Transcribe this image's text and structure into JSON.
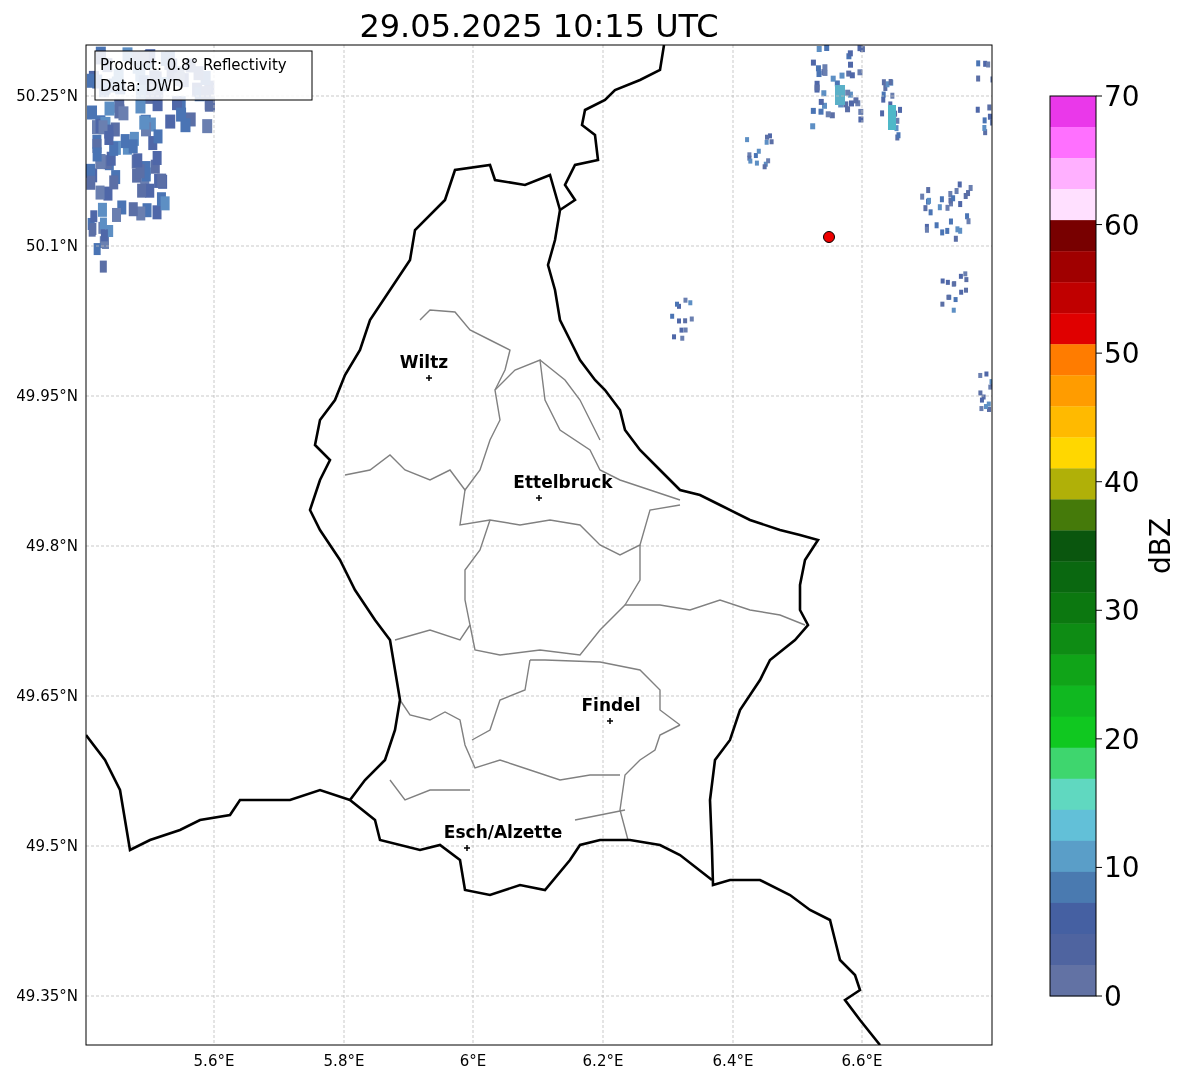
{
  "title": "29.05.2025 10:15 UTC",
  "map": {
    "info_box": [
      "Product: 0.8° Reflectivity",
      "Data: DWD"
    ],
    "cities": [
      {
        "name": "Wiltz"
      },
      {
        "name": "Ettelbruck"
      },
      {
        "name": "Findel"
      },
      {
        "name": "Esch/Alzette"
      }
    ],
    "y_ticks": [
      "50.25°N",
      "50.1°N",
      "49.95°N",
      "49.8°N",
      "49.65°N",
      "49.5°N",
      "49.35°N"
    ],
    "x_ticks": [
      "5.6°E",
      "5.8°E",
      "6°E",
      "6.2°E",
      "6.4°E",
      "6.6°E"
    ]
  },
  "colorbar": {
    "label": "dBZ",
    "ticks": [
      "70",
      "60",
      "50",
      "40",
      "30",
      "20",
      "10",
      "0"
    ],
    "segments": [
      {
        "color": "#ea38ea"
      },
      {
        "color": "#ff70ff"
      },
      {
        "color": "#ffb0ff"
      },
      {
        "color": "#ffe0ff"
      },
      {
        "color": "#780000"
      },
      {
        "color": "#a00000"
      },
      {
        "color": "#c00000"
      },
      {
        "color": "#e00000"
      },
      {
        "color": "#ff7c00"
      },
      {
        "color": "#ff9c00"
      },
      {
        "color": "#ffba00"
      },
      {
        "color": "#ffd700"
      },
      {
        "color": "#b0b008"
      },
      {
        "color": "#457a0a"
      },
      {
        "color": "#0a560e"
      },
      {
        "color": "#0a6810"
      },
      {
        "color": "#0c7810"
      },
      {
        "color": "#0e8c14"
      },
      {
        "color": "#10a418"
      },
      {
        "color": "#10b820"
      },
      {
        "color": "#10c820"
      },
      {
        "color": "#3ed66e"
      },
      {
        "color": "#60d8c0"
      },
      {
        "color": "#62c0d8"
      },
      {
        "color": "#5a9ec8"
      },
      {
        "color": "#4a7ab0"
      },
      {
        "color": "#4560a2"
      },
      {
        "color": "#4f64a0"
      },
      {
        "color": "#6272a4"
      }
    ]
  }
}
